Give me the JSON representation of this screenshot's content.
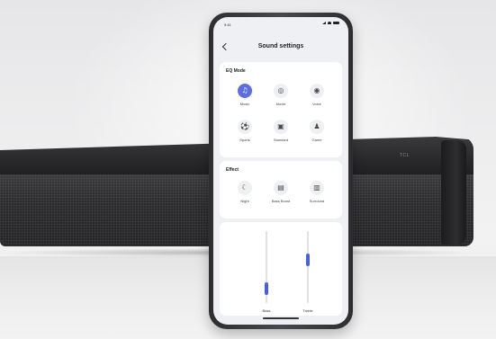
{
  "screen": {
    "status_time": "9:41",
    "title": "Sound settings"
  },
  "eq_mode": {
    "title": "EQ Mode",
    "options": [
      {
        "label": "Music",
        "icon": "music-note-icon",
        "glyph": "♫",
        "active": true
      },
      {
        "label": "Movie",
        "icon": "film-reel-icon",
        "glyph": "◎",
        "active": false
      },
      {
        "label": "Voice",
        "icon": "speaker-voice-icon",
        "glyph": "◉",
        "active": false
      },
      {
        "label": "Sports",
        "icon": "sports-icon",
        "glyph": "⚽",
        "active": false
      },
      {
        "label": "Standard",
        "icon": "standard-icon",
        "glyph": "▣",
        "active": false
      },
      {
        "label": "Game",
        "icon": "gamepad-icon",
        "glyph": "♟",
        "active": false
      }
    ]
  },
  "effect": {
    "title": "Effect",
    "options": [
      {
        "label": "Night",
        "icon": "moon-icon",
        "glyph": "☾"
      },
      {
        "label": "Bass Boost",
        "icon": "bass-boost-icon",
        "glyph": "▤"
      },
      {
        "label": "Surround",
        "icon": "surround-icon",
        "glyph": "▥"
      }
    ]
  },
  "sliders": [
    {
      "label": "Bass",
      "level": 0.2
    },
    {
      "label": "Treble",
      "level": 0.6
    }
  ],
  "soundbar": {
    "brand": "TCL"
  },
  "colors": {
    "accent": "#5b6fe0",
    "slider_fill": "#4a5fe0",
    "soundbar": "#2b2b2d"
  }
}
